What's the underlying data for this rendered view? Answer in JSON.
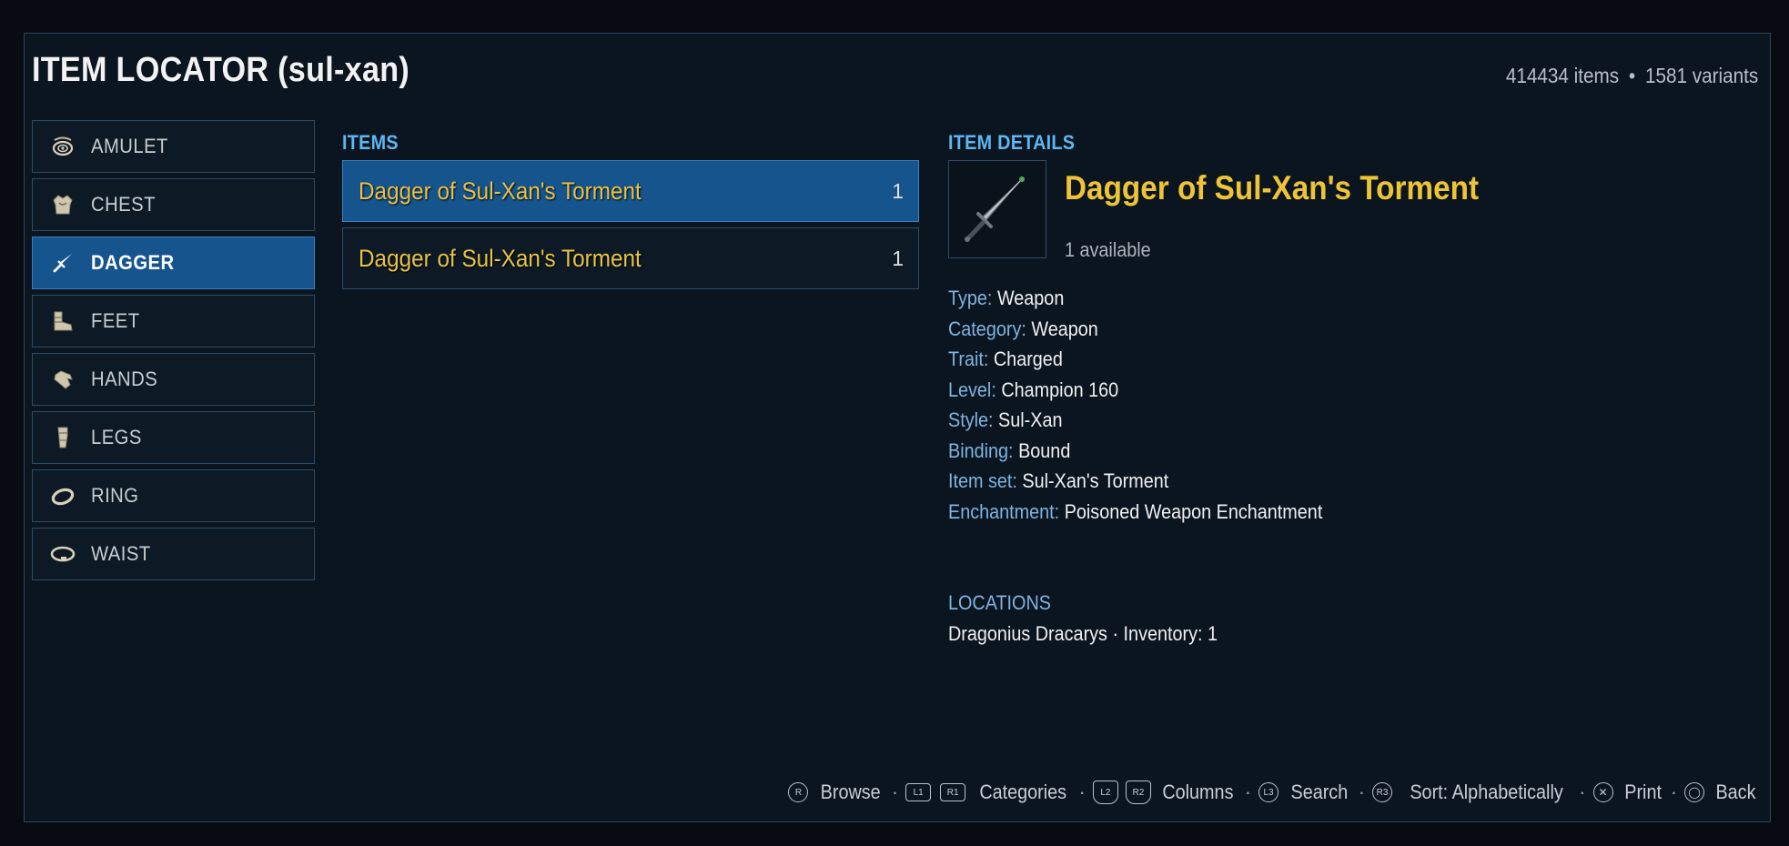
{
  "header": {
    "title": "ITEM LOCATOR (sul-xan)",
    "items_count": "414434 items",
    "bullet": "•",
    "variants_count": "1581 variants"
  },
  "categories": [
    {
      "label": "AMULET",
      "icon": "amulet-icon"
    },
    {
      "label": "CHEST",
      "icon": "chest-armor-icon"
    },
    {
      "label": "DAGGER",
      "icon": "dagger-icon",
      "selected": true
    },
    {
      "label": "FEET",
      "icon": "boot-icon"
    },
    {
      "label": "HANDS",
      "icon": "glove-icon"
    },
    {
      "label": "LEGS",
      "icon": "leg-armor-icon"
    },
    {
      "label": "RING",
      "icon": "ring-icon"
    },
    {
      "label": "WAIST",
      "icon": "belt-icon"
    }
  ],
  "items_column": {
    "heading": "ITEMS",
    "rows": [
      {
        "name": "Dagger of Sul-Xan's Torment",
        "qty": "1",
        "selected": true
      },
      {
        "name": "Dagger of Sul-Xan's Torment",
        "qty": "1"
      }
    ]
  },
  "details": {
    "heading": "ITEM DETAILS",
    "name": "Dagger of Sul-Xan's Torment",
    "available": "1 available",
    "properties": [
      {
        "key": "Type:",
        "value": "Weapon"
      },
      {
        "key": "Category:",
        "value": "Weapon"
      },
      {
        "key": "Trait:",
        "value": "Charged"
      },
      {
        "key": "Level:",
        "value": "Champion 160"
      },
      {
        "key": "Style:",
        "value": "Sul-Xan"
      },
      {
        "key": "Binding:",
        "value": "Bound"
      },
      {
        "key": "Item set:",
        "value": "Sul-Xan's Torment"
      },
      {
        "key": "Enchantment:",
        "value": "Poisoned Weapon Enchantment"
      }
    ],
    "locations_heading": "LOCATIONS",
    "location": "Dragonius Dracarys · Inventory: 1"
  },
  "footer": {
    "sep": "·",
    "browse": {
      "key": "R",
      "label": "Browse"
    },
    "categories": {
      "key1": "L1",
      "key2": "R1",
      "label": "Categories"
    },
    "columns": {
      "key1": "L2",
      "key2": "R2",
      "label": "Columns"
    },
    "search": {
      "key": "L3",
      "label": "Search"
    },
    "sort": {
      "key": "R3",
      "label": "Sort: Alphabetically"
    },
    "print": {
      "key": "✕",
      "label": "Print"
    },
    "back": {
      "key": "◯",
      "label": "Back"
    }
  },
  "colors": {
    "background": "#080c12",
    "panel": "#0b1520",
    "selected": "#16548d",
    "accent_blue": "#5fb6f0",
    "item_gold": "#e7c24a"
  }
}
